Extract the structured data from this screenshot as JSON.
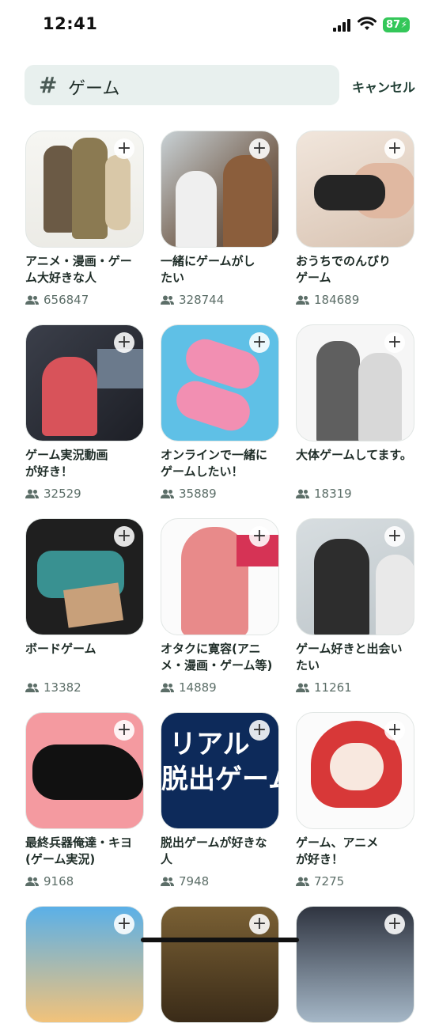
{
  "status_bar": {
    "time": "12:41",
    "battery": "87"
  },
  "search": {
    "query": "ゲーム",
    "cancel_label": "キャンセル"
  },
  "cards": [
    {
      "title_line1": "アニメ・漫画・ゲー",
      "title_line2": "ム大好きな人",
      "count": "656847",
      "image": "anime-group"
    },
    {
      "title_line1": "一緒にゲームがし",
      "title_line2": "たい",
      "count": "328744",
      "image": "gaming-friends"
    },
    {
      "title_line1": "おうちでのんびり",
      "title_line2": "ゲーム",
      "count": "184689",
      "image": "hands-controller"
    },
    {
      "title_line1": "ゲーム実況動画",
      "title_line2": "が好き！",
      "count": "32529",
      "image": "streamer"
    },
    {
      "title_line1": "オンラインで一緒に",
      "title_line2": "ゲームしたい！",
      "count": "35889",
      "image": "pink-controllers"
    },
    {
      "title_line1": "大体ゲームしてます。",
      "title_line2": "",
      "count": "18319",
      "image": "manga-couple"
    },
    {
      "title_line1": "ボードゲーム",
      "title_line2": "",
      "count": "13382",
      "image": "boardgame"
    },
    {
      "title_line1": "オタクに寛容(アニ",
      "title_line2": "メ・漫画・ゲーム等)",
      "count": "14889",
      "image": "light-novel"
    },
    {
      "title_line1": "ゲーム好きと出会い",
      "title_line2": "たい",
      "count": "11261",
      "image": "photo-pair"
    },
    {
      "title_line1": "最終兵器俺達・キヨ",
      "title_line2": "(ゲーム実況)",
      "count": "9168",
      "image": "black-cat"
    },
    {
      "title_line1": "脱出ゲームが好きな",
      "title_line2": "人",
      "count": "7948",
      "image": "escape"
    },
    {
      "title_line1": "ゲーム、アニメ",
      "title_line2": "が好き！",
      "count": "7275",
      "image": "red-hood"
    }
  ],
  "escape_image_text": {
    "line1": "リアル",
    "line2": "脱出ゲーム"
  },
  "colors": {
    "search_bg": "#e8f0ee",
    "text": "#1f2d28",
    "count": "#5c6e68",
    "battery": "#34c759"
  }
}
